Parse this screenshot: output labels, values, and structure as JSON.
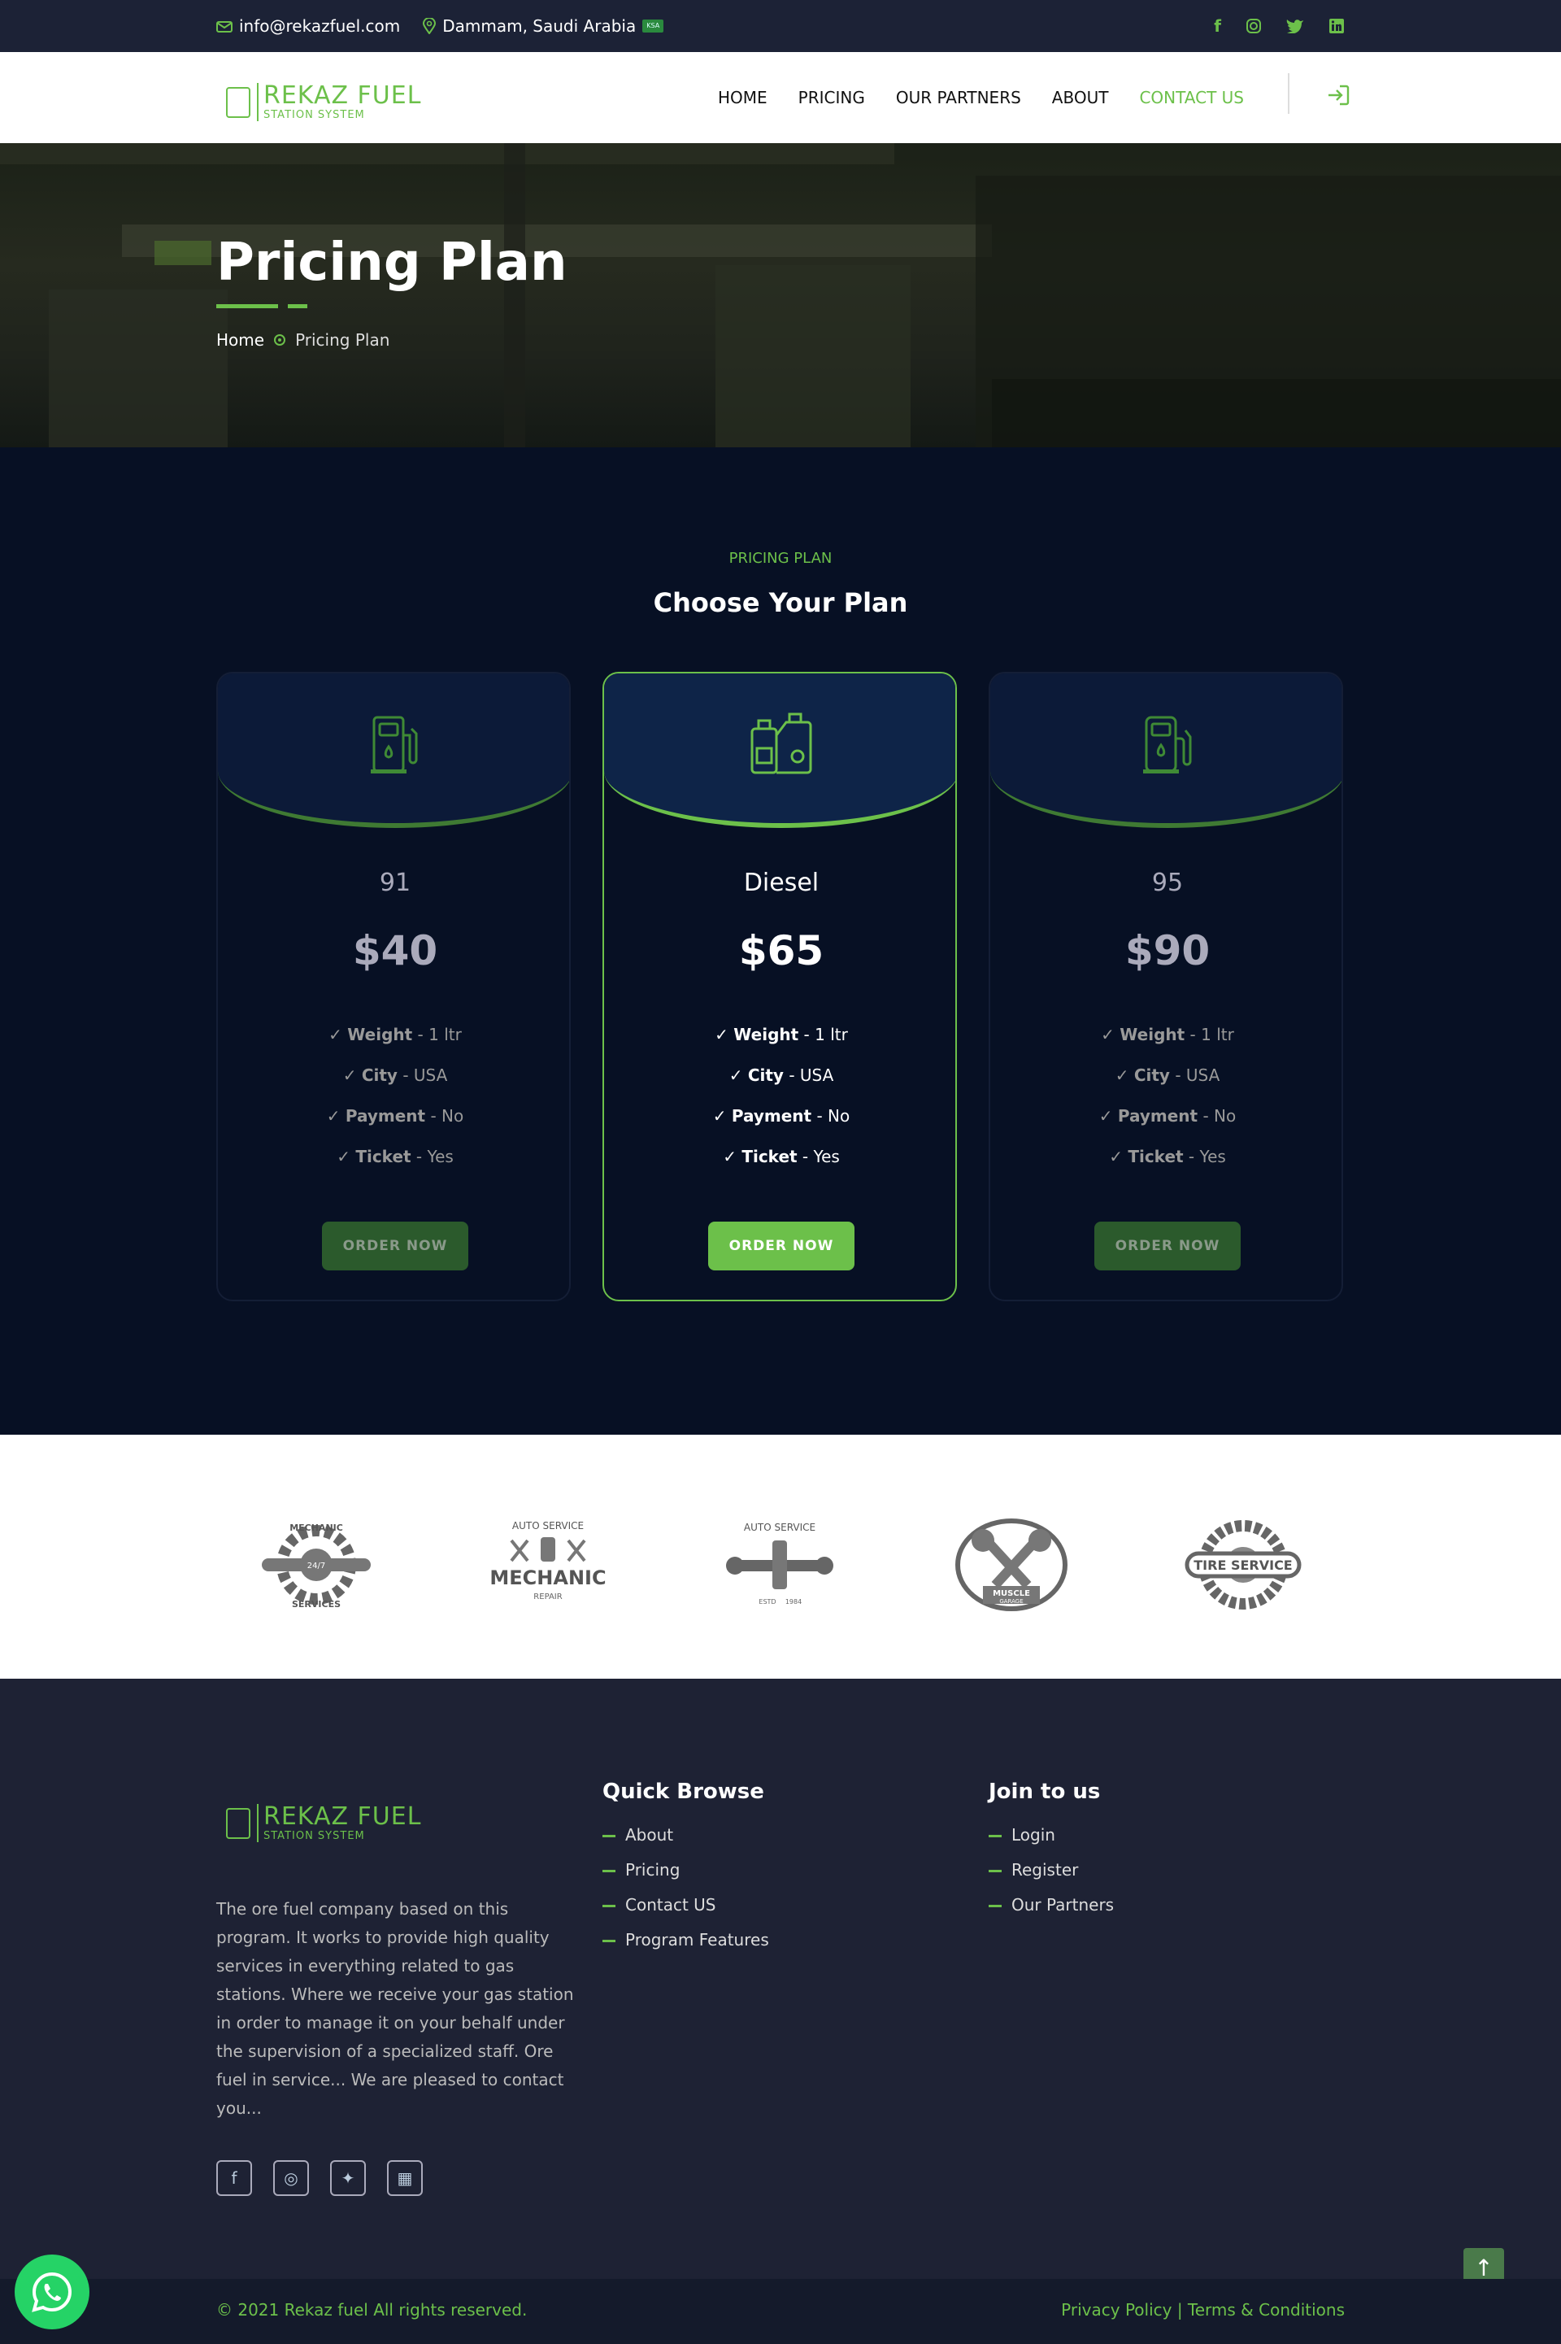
{
  "topbar": {
    "email": "info@rekazfuel.com",
    "location": "Dammam, Saudi Arabia",
    "flag_label": "KSA",
    "social": [
      "f",
      "ig",
      "tw",
      "in"
    ]
  },
  "nav": {
    "logo_name": "REKAZ FUEL",
    "logo_sub": "STATION SYSTEM",
    "items": [
      {
        "label": "HOME"
      },
      {
        "label": "PRICING"
      },
      {
        "label": "OUR PARTNERS"
      },
      {
        "label": "ABOUT"
      },
      {
        "label": "CONTACT US"
      }
    ],
    "login_icon": "login-icon"
  },
  "hero": {
    "title": "Pricing Plan",
    "crumb_home": "Home",
    "crumb_current": "Pricing Plan"
  },
  "pricing": {
    "eyebrow": "PRICING PLAN",
    "title": "Choose Your Plan",
    "plans": [
      {
        "name": "91",
        "price": "$40",
        "weight_label": "Weight",
        "weight": " - 1 ltr",
        "city_label": "City",
        "city": " - USA",
        "payment_label": "Payment",
        "payment": " - No",
        "ticket_label": "Ticket",
        "ticket": " - Yes",
        "button": "ORDER NOW"
      },
      {
        "name": "Diesel",
        "price": "$65",
        "weight_label": "Weight",
        "weight": " - 1 ltr",
        "city_label": "City",
        "city": " - USA",
        "payment_label": "Payment",
        "payment": " - No",
        "ticket_label": "Ticket",
        "ticket": " - Yes",
        "button": "ORDER NOW"
      },
      {
        "name": "95",
        "price": "$90",
        "weight_label": "Weight",
        "weight": " - 1 ltr",
        "city_label": "City",
        "city": " - USA",
        "payment_label": "Payment",
        "payment": " - No",
        "ticket_label": "Ticket",
        "ticket": " - Yes",
        "button": "ORDER NOW"
      }
    ]
  },
  "partners": {
    "logos": [
      {
        "t1": "MECHANIC",
        "t2": "24/7",
        "t3": "SERVICES"
      },
      {
        "t1": "AUTO SERVICE",
        "t2": "MECHANIC",
        "t3": "REPAIR"
      },
      {
        "t1": "AUTO SERVICE",
        "t2": "ESTD",
        "t3": "1984"
      },
      {
        "t1": "MUSCLE",
        "t2": "GARAGE",
        "t3": ""
      },
      {
        "t1": "TIRE SERVICE",
        "t2": "",
        "t3": ""
      }
    ]
  },
  "footer": {
    "logo_name": "REKAZ FUEL",
    "logo_sub": "STATION SYSTEM",
    "description": "The ore fuel company based on this program. It works to provide high quality services in everything related to gas stations. Where we receive your gas station in order to manage it on your behalf under the supervision of a specialized staff. Ore fuel in service... We are pleased to contact you...",
    "quick_title": "Quick Browse",
    "quick_links": [
      "About",
      "Pricing",
      "Contact US",
      "Program Features"
    ],
    "join_title": "Join to us",
    "join_links": [
      "Login",
      "Register",
      "Our Partners"
    ],
    "social": [
      "f",
      "ig",
      "tw",
      "in"
    ],
    "copyright": "© 2021 Rekaz fuel All rights reserved.",
    "legal": "Privacy Policy | Terms & Conditions"
  },
  "colors": {
    "accent": "#6cc04a",
    "dark": "#071024",
    "footer": "#1e2234"
  }
}
